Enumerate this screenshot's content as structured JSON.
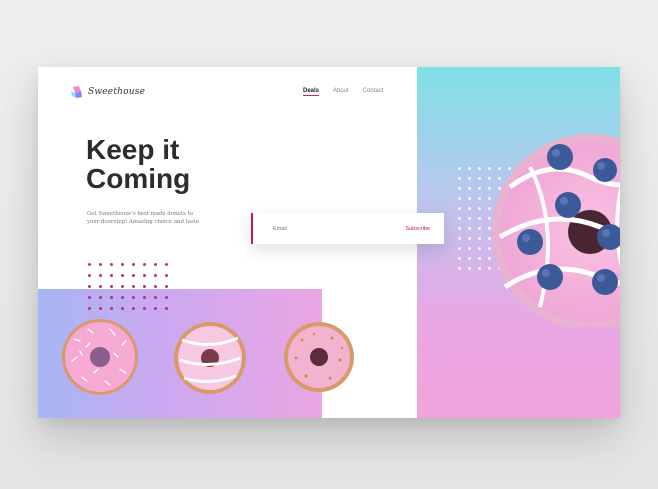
{
  "brand": {
    "name": "Sweethouse"
  },
  "nav": {
    "items": [
      "Deals",
      "About",
      "Contact"
    ],
    "active": "Deals"
  },
  "hero": {
    "title_line1": "Keep it",
    "title_line2": "Coming",
    "description": "Get Sweethouse's best made donuts to your doorstep! Amazing choice and taste"
  },
  "subscribe": {
    "placeholder": "Email",
    "button_label": "Subscribe"
  },
  "colors": {
    "accent": "#c2185b",
    "panel_top": "#7fe0e6",
    "panel_bottom": "#f2a3dc"
  },
  "images": {
    "large": "blueberry-donut",
    "small": [
      "coconut-donut",
      "pink-striped-donut",
      "sprinkle-donut"
    ]
  }
}
